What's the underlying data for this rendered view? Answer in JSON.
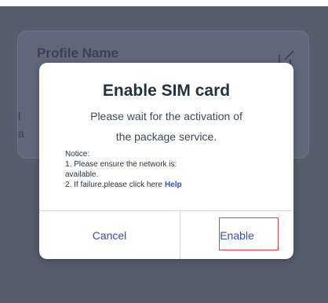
{
  "background_card": {
    "profile_label": "Profile Name",
    "fragment_1": "l",
    "fragment_2": "a",
    "edit_icon": "edit-icon"
  },
  "dialog": {
    "title": "Enable SIM card",
    "message_line1": "Please wait for the activation of",
    "message_line2": "the package service.",
    "notice": {
      "heading": "Notice:",
      "line1": "1. Please ensure the network is:",
      "line2": "available.",
      "line3": "2. If failure,please click here",
      "help_link": "Help"
    },
    "cancel_label": "Cancel",
    "enable_label": "Enable"
  },
  "colors": {
    "overlay": "#555c6c",
    "title": "#1f3340",
    "button_text": "#3a4fa8",
    "help_link": "#2a55c8",
    "highlight_outline": "#e0413a"
  }
}
